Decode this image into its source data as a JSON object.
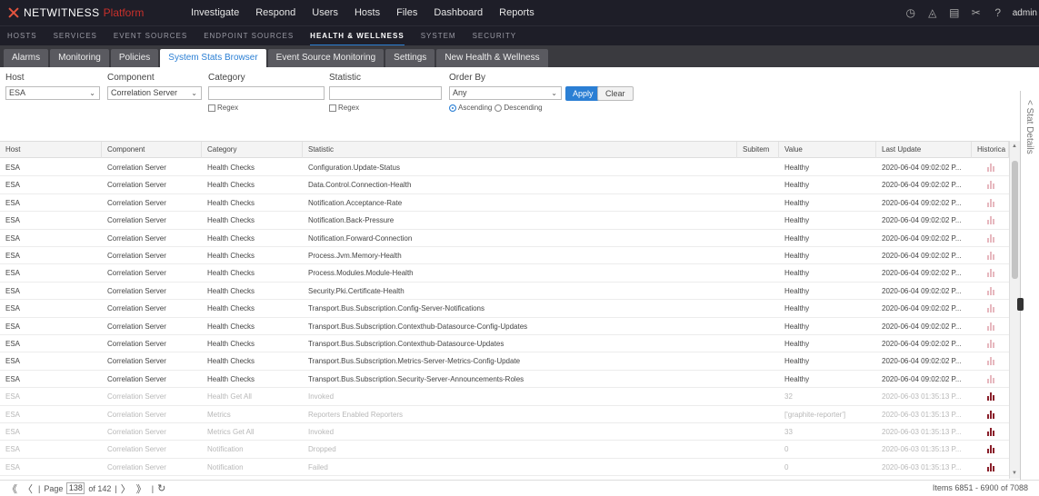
{
  "app": {
    "brand": "NETWITNESS",
    "brand_sub": "Platform",
    "user": "admin",
    "main_nav": [
      "Investigate",
      "Respond",
      "Users",
      "Hosts",
      "Files",
      "Dashboard",
      "Reports"
    ],
    "icons": [
      "timer-icon",
      "bell-icon",
      "notes-icon",
      "tools-icon",
      "help-icon"
    ],
    "icon_glyphs": [
      "◷",
      "◬",
      "▤",
      "✂",
      "?"
    ]
  },
  "subnav": {
    "items": [
      "HOSTS",
      "SERVICES",
      "EVENT SOURCES",
      "ENDPOINT SOURCES",
      "HEALTH & WELLNESS",
      "SYSTEM",
      "SECURITY"
    ],
    "active": "HEALTH & WELLNESS"
  },
  "tabs": {
    "items": [
      "Alarms",
      "Monitoring",
      "Policies",
      "System Stats Browser",
      "Event Source Monitoring",
      "Settings",
      "New Health & Wellness"
    ],
    "active": "System Stats Browser"
  },
  "filters": {
    "host_label": "Host",
    "host_value": "ESA",
    "component_label": "Component",
    "component_value": "Correlation Server",
    "category_label": "Category",
    "category_value": "",
    "statistic_label": "Statistic",
    "statistic_value": "",
    "order_label": "Order By",
    "order_value": "Any",
    "regex_label": "Regex",
    "ascending_label": "Ascending",
    "descending_label": "Descending",
    "apply_label": "Apply",
    "clear_label": "Clear"
  },
  "grid": {
    "columns": [
      "Host",
      "Component",
      "Category",
      "Statistic",
      "Subitem",
      "Value",
      "Last Update",
      "Historica"
    ],
    "rows": [
      {
        "host": "ESA",
        "component": "Correlation Server",
        "category": "Health Checks",
        "statistic": "Configuration.Update-Status",
        "subitem": "",
        "value": "Healthy",
        "last_update": "2020-06-04 09:02:02 P...",
        "dim": false
      },
      {
        "host": "ESA",
        "component": "Correlation Server",
        "category": "Health Checks",
        "statistic": "Data.Control.Connection-Health",
        "subitem": "",
        "value": "Healthy",
        "last_update": "2020-06-04 09:02:02 P...",
        "dim": false
      },
      {
        "host": "ESA",
        "component": "Correlation Server",
        "category": "Health Checks",
        "statistic": "Notification.Acceptance-Rate",
        "subitem": "",
        "value": "Healthy",
        "last_update": "2020-06-04 09:02:02 P...",
        "dim": false
      },
      {
        "host": "ESA",
        "component": "Correlation Server",
        "category": "Health Checks",
        "statistic": "Notification.Back-Pressure",
        "subitem": "",
        "value": "Healthy",
        "last_update": "2020-06-04 09:02:02 P...",
        "dim": false
      },
      {
        "host": "ESA",
        "component": "Correlation Server",
        "category": "Health Checks",
        "statistic": "Notification.Forward-Connection",
        "subitem": "",
        "value": "Healthy",
        "last_update": "2020-06-04 09:02:02 P...",
        "dim": false
      },
      {
        "host": "ESA",
        "component": "Correlation Server",
        "category": "Health Checks",
        "statistic": "Process.Jvm.Memory-Health",
        "subitem": "",
        "value": "Healthy",
        "last_update": "2020-06-04 09:02:02 P...",
        "dim": false
      },
      {
        "host": "ESA",
        "component": "Correlation Server",
        "category": "Health Checks",
        "statistic": "Process.Modules.Module-Health",
        "subitem": "",
        "value": "Healthy",
        "last_update": "2020-06-04 09:02:02 P...",
        "dim": false
      },
      {
        "host": "ESA",
        "component": "Correlation Server",
        "category": "Health Checks",
        "statistic": "Security.Pki.Certificate-Health",
        "subitem": "",
        "value": "Healthy",
        "last_update": "2020-06-04 09:02:02 P...",
        "dim": false
      },
      {
        "host": "ESA",
        "component": "Correlation Server",
        "category": "Health Checks",
        "statistic": "Transport.Bus.Subscription.Config-Server-Notifications",
        "subitem": "",
        "value": "Healthy",
        "last_update": "2020-06-04 09:02:02 P...",
        "dim": false
      },
      {
        "host": "ESA",
        "component": "Correlation Server",
        "category": "Health Checks",
        "statistic": "Transport.Bus.Subscription.Contexthub-Datasource-Config-Updates",
        "subitem": "",
        "value": "Healthy",
        "last_update": "2020-06-04 09:02:02 P...",
        "dim": false
      },
      {
        "host": "ESA",
        "component": "Correlation Server",
        "category": "Health Checks",
        "statistic": "Transport.Bus.Subscription.Contexthub-Datasource-Updates",
        "subitem": "",
        "value": "Healthy",
        "last_update": "2020-06-04 09:02:02 P...",
        "dim": false
      },
      {
        "host": "ESA",
        "component": "Correlation Server",
        "category": "Health Checks",
        "statistic": "Transport.Bus.Subscription.Metrics-Server-Metrics-Config-Update",
        "subitem": "",
        "value": "Healthy",
        "last_update": "2020-06-04 09:02:02 P...",
        "dim": false
      },
      {
        "host": "ESA",
        "component": "Correlation Server",
        "category": "Health Checks",
        "statistic": "Transport.Bus.Subscription.Security-Server-Announcements-Roles",
        "subitem": "",
        "value": "Healthy",
        "last_update": "2020-06-04 09:02:02 P...",
        "dim": false
      },
      {
        "host": "ESA",
        "component": "Correlation Server",
        "category": "Health Get All",
        "statistic": "Invoked",
        "subitem": "",
        "value": "32",
        "last_update": "2020-06-03 01:35:13 P...",
        "dim": true
      },
      {
        "host": "ESA",
        "component": "Correlation Server",
        "category": "Metrics",
        "statistic": "Reporters Enabled Reporters",
        "subitem": "",
        "value": "['graphite-reporter']",
        "last_update": "2020-06-03 01:35:13 P...",
        "dim": true
      },
      {
        "host": "ESA",
        "component": "Correlation Server",
        "category": "Metrics Get All",
        "statistic": "Invoked",
        "subitem": "",
        "value": "33",
        "last_update": "2020-06-03 01:35:13 P...",
        "dim": true
      },
      {
        "host": "ESA",
        "component": "Correlation Server",
        "category": "Notification",
        "statistic": "Dropped",
        "subitem": "",
        "value": "0",
        "last_update": "2020-06-03 01:35:13 P...",
        "dim": true
      },
      {
        "host": "ESA",
        "component": "Correlation Server",
        "category": "Notification",
        "statistic": "Failed",
        "subitem": "",
        "value": "0",
        "last_update": "2020-06-03 01:35:13 P...",
        "dim": true
      }
    ]
  },
  "side_panel": {
    "title": "< Stat Details"
  },
  "pager": {
    "first": "《",
    "prev": "〈",
    "page_label": "Page",
    "page_value": "138",
    "of_label": "of 142",
    "next": "〉",
    "last": "》",
    "refresh": "↻",
    "sep": "|",
    "items_text": "Items 6851 - 6900 of 7088"
  },
  "colors": {
    "accent": "#2b7fd4",
    "nav_bg": "#1e1e28",
    "brand_red": "#c8302b"
  }
}
